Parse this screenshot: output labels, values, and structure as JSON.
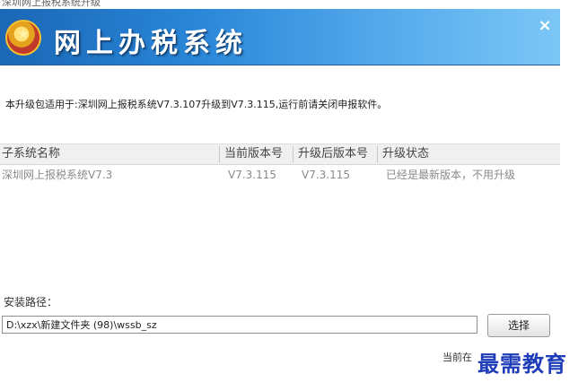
{
  "window": {
    "caption_fragment": "深圳网上报税系统升级",
    "app_title": "网上办税系统",
    "close_symbol": "×"
  },
  "description": "本升级包适用于:深圳网上报税系统V7.3.107升级到V7.3.115,运行前请关闭申报软件。",
  "table": {
    "headers": [
      "子系统名称",
      "当前版本号",
      "升级后版本号",
      "升级状态"
    ],
    "rows": [
      [
        "深圳网上报税系统V7.3",
        "V7.3.115",
        "V7.3.115",
        "已经是最新版本，不用升级"
      ]
    ]
  },
  "install": {
    "label": "安装路径：",
    "path": "D:\\xzx\\新建文件夹 (98)\\wssb_sz",
    "browse_label": "选择"
  },
  "status": "当前在",
  "watermark": "最需教育"
}
